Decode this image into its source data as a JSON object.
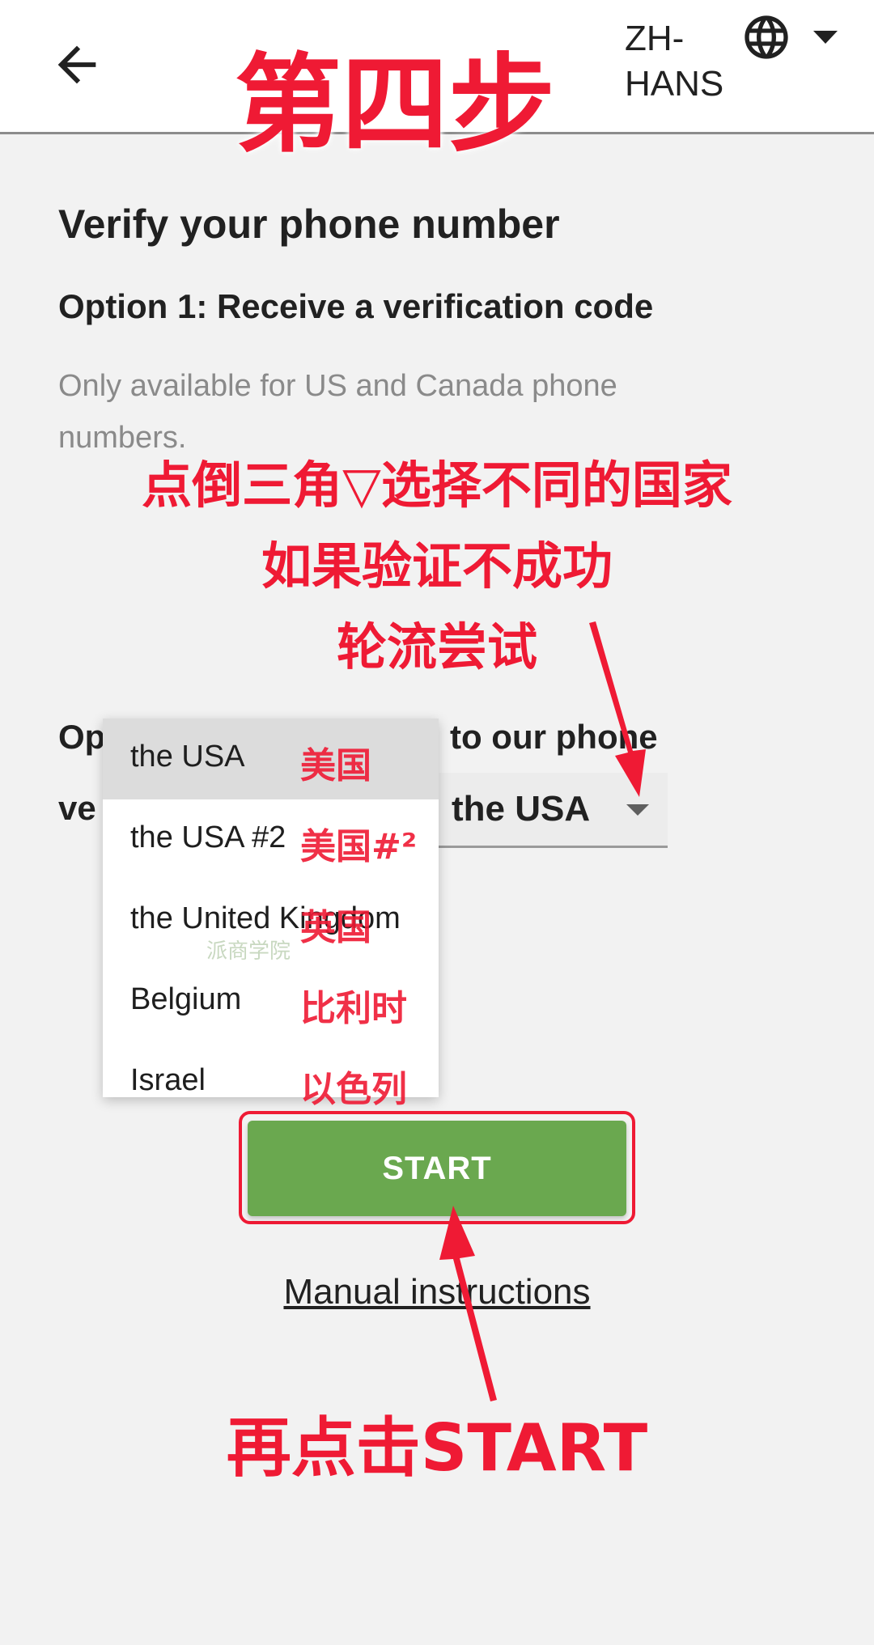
{
  "topbar": {
    "back_icon": "arrow-left-icon",
    "language_label": "ZH-\nHANS",
    "globe_icon": "globe-icon",
    "caret_icon": "caret-down-icon"
  },
  "annotations": {
    "step": "第四步",
    "line1": "点倒三角▽选择不同的国家",
    "line2": "如果验证不成功",
    "line3": "轮流尝试",
    "bottom": "再点击START",
    "color": "#ef1a34"
  },
  "main": {
    "heading": "Verify your phone number",
    "option1_title": "Option 1: Receive a verification code",
    "option1_note": "Only available for US and Canada phone numbers.",
    "option2_part_left": "Op",
    "option2_part_right": "to our phone",
    "option2_line2_left": "ve",
    "country_select_value": "the USA"
  },
  "dropdown": {
    "items": [
      {
        "label": "the USA",
        "zh": "美国",
        "selected": true
      },
      {
        "label": "the USA #2",
        "zh": "美国#²",
        "selected": false
      },
      {
        "label": "the United Kingdom",
        "zh": "英国",
        "selected": false
      },
      {
        "label": "Belgium",
        "zh": "比利时",
        "selected": false
      },
      {
        "label": "Israel",
        "zh": "以色列",
        "selected": false
      }
    ],
    "watermark": "派商学院"
  },
  "actions": {
    "start_label": "START",
    "manual_link": "Manual instructions",
    "button_color": "#6aa84f"
  }
}
